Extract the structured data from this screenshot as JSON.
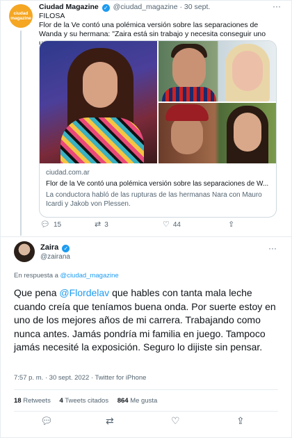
{
  "parent_tweet": {
    "avatar_text": [
      "ciudad",
      "magazine"
    ],
    "name": "Ciudad Magazine",
    "handle": "@ciudad_magazine",
    "time": "30 sept.",
    "body": "FILOSA\nFlor de la Ve contó una polémica versión sobre las separaciones de Wanda y su hermana: \"Zaira está sin trabajo y necesita conseguir uno urgente\"",
    "card": {
      "domain": "ciudad.com.ar",
      "title": "Flor de la Ve contó una polémica versión sobre las separaciones de W...",
      "description": "La conductora habló de las rupturas de las hermanas Nara con Mauro Icardi y Jakob von Plessen."
    },
    "actions": {
      "replies": "15",
      "retweets": "3",
      "likes": "44"
    }
  },
  "main_tweet": {
    "name": "Zaira",
    "handle": "@zairana",
    "reply_prefix": "En respuesta a",
    "reply_to": "@ciudad_magazine",
    "text_before": "Que pena ",
    "mention": "@Flordelav",
    "text_after": " que hables con tanta mala leche cuando creía que teníamos buena onda. Por suerte estoy en uno de los mejores años de mi carrera. Trabajando como nunca antes. Jamás pondría mi familia en juego. Tampoco jamás necesité la exposición. Seguro lo dijiste sin pensar.",
    "meta": "7:57 p. m. · 30 sept. 2022 · Twitter for iPhone",
    "stats": {
      "retweets_count": "18",
      "retweets_label": "Retweets",
      "quotes_count": "4",
      "quotes_label": "Tweets citados",
      "likes_count": "864",
      "likes_label": "Me gusta"
    }
  },
  "icons": {
    "reply": "reply-icon",
    "retweet": "retweet-icon",
    "like": "heart-icon",
    "share": "share-icon",
    "verified": "verified-badge-icon",
    "more": "more-icon"
  },
  "colors": {
    "accent": "#1d9bf0",
    "text": "#0f1419",
    "muted": "#536471",
    "brand": "#f5a623"
  }
}
